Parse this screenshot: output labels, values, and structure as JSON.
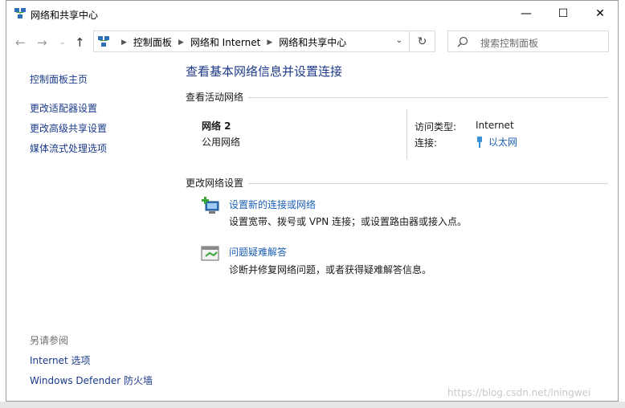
{
  "window": {
    "title": "网络和共享中心",
    "minimize": "—",
    "maximize": "☐",
    "close": "✕"
  },
  "nav": {
    "back": "←",
    "forward": "→",
    "recent": "⌄",
    "up": "↑",
    "breadcrumbs": [
      "控制面板",
      "网络和 Internet",
      "网络和共享中心"
    ],
    "search_placeholder": "搜索控制面板"
  },
  "sidebar": {
    "home": "控制面板主页",
    "links": [
      "更改适配器设置",
      "更改高级共享设置",
      "媒体流式处理选项"
    ],
    "see_also_heading": "另请参阅",
    "see_also": [
      "Internet 选项",
      "Windows Defender 防火墙"
    ]
  },
  "main": {
    "title": "查看基本网络信息并设置连接",
    "active_section": "查看活动网络",
    "network": {
      "name": "网络 2",
      "category": "公用网络",
      "access_label": "访问类型:",
      "access_value": "Internet",
      "conn_label": "连接:",
      "conn_value": "以太网"
    },
    "change_section": "更改网络设置",
    "tasks": [
      {
        "title": "设置新的连接或网络",
        "desc": "设置宽带、拨号或 VPN 连接；或设置路由器或接入点。"
      },
      {
        "title": "问题疑难解答",
        "desc": "诊断并修复网络问题，或者获得疑难解答信息。"
      }
    ]
  },
  "watermark": "https://blog.csdn.net/lningwei",
  "colors": {
    "link": "#1a5fb4",
    "title": "#1e3a8a",
    "sidebar_link": "#1a3a8a"
  }
}
